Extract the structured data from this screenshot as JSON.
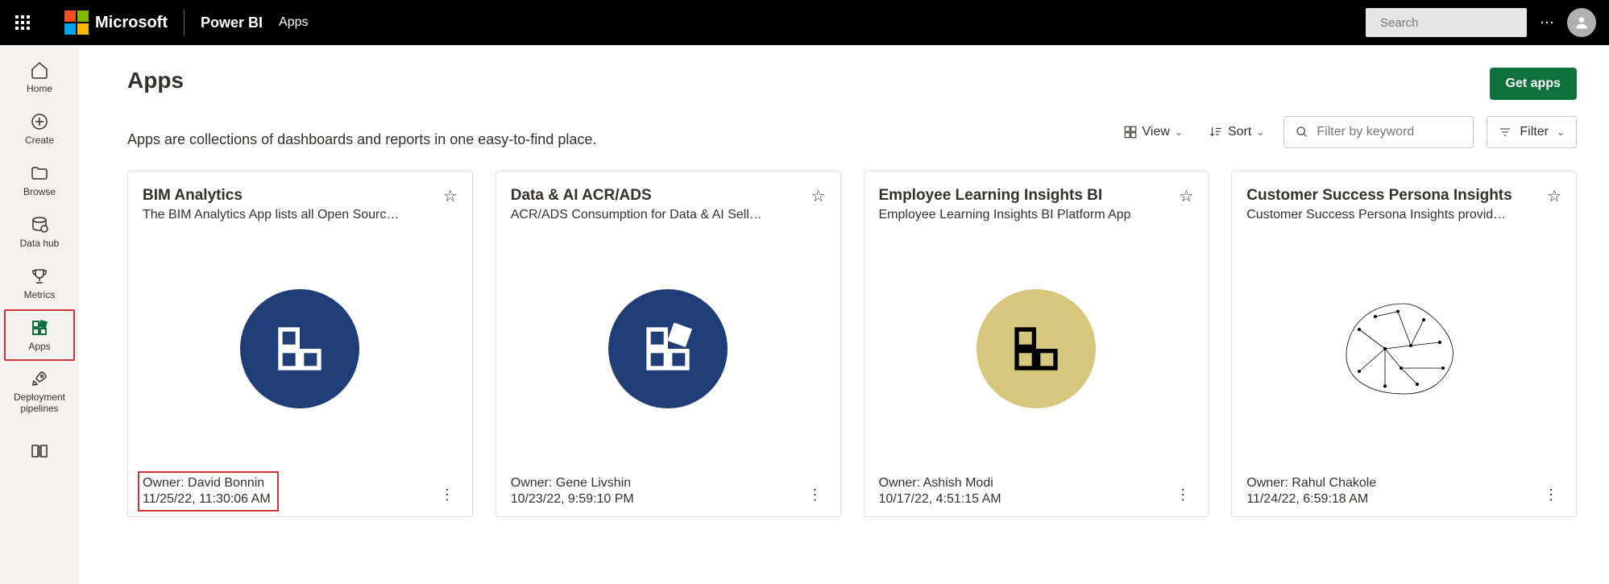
{
  "header": {
    "ms_word": "Microsoft",
    "brand": "Power BI",
    "breadcrumb": "Apps",
    "search_placeholder": "Search"
  },
  "leftnav": {
    "home": "Home",
    "create": "Create",
    "browse": "Browse",
    "datahub": "Data hub",
    "metrics": "Metrics",
    "apps": "Apps",
    "pipelines": "Deployment pipelines"
  },
  "page": {
    "title": "Apps",
    "subtitle": "Apps are collections of dashboards and reports in one easy-to-find place.",
    "get_apps": "Get apps"
  },
  "toolbar": {
    "view": "View",
    "sort": "Sort",
    "filter_placeholder": "Filter by keyword",
    "filter_btn": "Filter"
  },
  "cards": [
    {
      "title": "BIM Analytics",
      "desc": "The BIM Analytics App lists all Open Sourc…",
      "owner": "Owner: David Bonnin",
      "timestamp": "11/25/22, 11:30:06 AM",
      "highlight_footer": true,
      "icon": "grid-white",
      "icon_bg": "bg-navy"
    },
    {
      "title": "Data & AI ACR/ADS",
      "desc": "ACR/ADS Consumption for Data & AI Sell…",
      "owner": "Owner: Gene Livshin",
      "timestamp": "10/23/22, 9:59:10 PM",
      "highlight_footer": false,
      "icon": "grid-sparkle-white",
      "icon_bg": "bg-navy"
    },
    {
      "title": "Employee Learning Insights BI",
      "desc": "Employee Learning Insights BI Platform App",
      "owner": "Owner: Ashish Modi",
      "timestamp": "10/17/22, 4:51:15 AM",
      "highlight_footer": false,
      "icon": "grid-black",
      "icon_bg": "bg-gold"
    },
    {
      "title": "Customer Success Persona Insights",
      "desc": "Customer Success Persona Insights provid…",
      "owner": "Owner: Rahul Chakole",
      "timestamp": "11/24/22, 6:59:18 AM",
      "highlight_footer": false,
      "icon": "brain",
      "icon_bg": ""
    }
  ]
}
